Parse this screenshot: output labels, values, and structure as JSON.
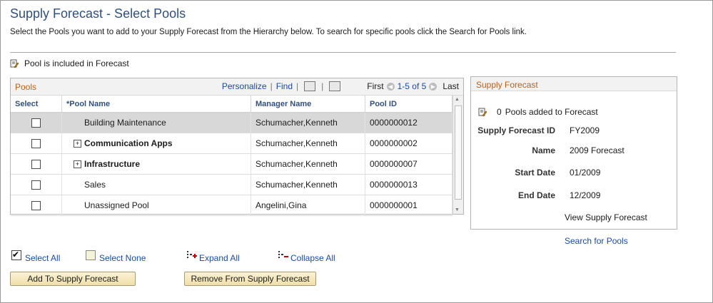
{
  "page": {
    "title": "Supply Forecast - Select Pools",
    "instructions": "Select the Pools you want to add to your Supply Forecast from the Hierarchy below. To search for specific pools click the Search for Pools link.",
    "legend": "Pool is included in Forecast"
  },
  "grid": {
    "title": "Pools",
    "personalize": "Personalize",
    "find": "Find",
    "first": "First",
    "range": "1-5 of 5",
    "last": "Last",
    "columns": {
      "select": "Select",
      "pool_name": "*Pool Name",
      "manager_name": "Manager Name",
      "pool_id": "Pool ID"
    },
    "rows": [
      {
        "pool_name": "Building Maintenance",
        "manager": "Schumacher,Kenneth",
        "pool_id": "0000000012"
      },
      {
        "pool_name": "Communication Apps",
        "manager": "Schumacher,Kenneth",
        "pool_id": "0000000002"
      },
      {
        "pool_name": "Infrastructure",
        "manager": "Schumacher,Kenneth",
        "pool_id": "0000000007"
      },
      {
        "pool_name": "Sales",
        "manager": "Schumacher,Kenneth",
        "pool_id": "0000000013"
      },
      {
        "pool_name": "Unassigned Pool",
        "manager": "Angelini,Gina",
        "pool_id": "0000000001"
      }
    ]
  },
  "supply_forecast": {
    "title": "Supply Forecast",
    "count": "0",
    "count_label": "Pools added to Forecast",
    "id_label": "Supply Forecast ID",
    "id_value": "FY2009",
    "name_label": "Name",
    "name_value": "2009 Forecast",
    "start_label": "Start Date",
    "start_value": "01/2009",
    "end_label": "End Date",
    "end_value": "12/2009",
    "view_link": "View Supply Forecast"
  },
  "links": {
    "search_pools": "Search for Pools",
    "select_all": "Select All",
    "select_none": "Select None",
    "expand_all": "Expand All",
    "collapse_all": "Collapse All"
  },
  "buttons": {
    "add": "Add To Supply Forecast",
    "remove": "Remove From Supply Forecast"
  },
  "colors": {
    "title": "#31507d",
    "link": "#1b4a9a",
    "section_title": "#b6621e",
    "button": "#f0dfa9"
  }
}
